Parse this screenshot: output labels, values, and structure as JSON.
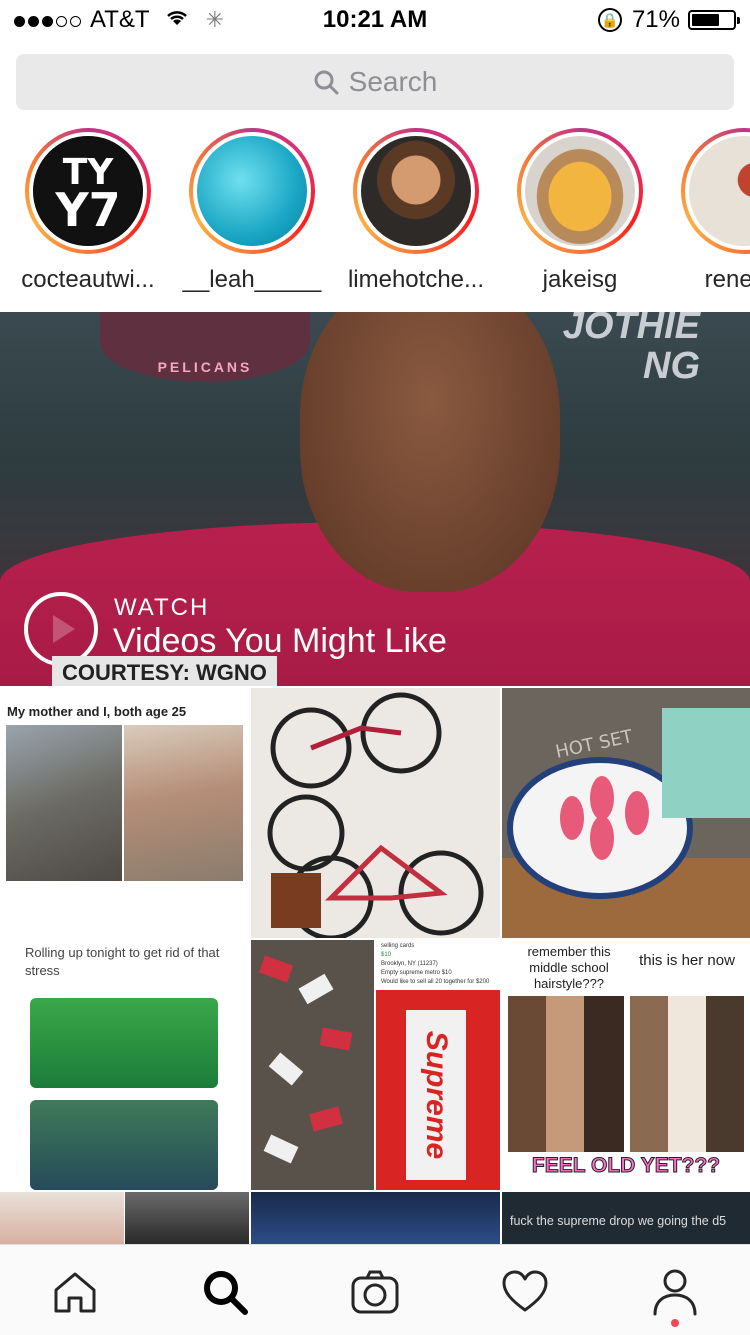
{
  "status_bar": {
    "carrier": "AT&T",
    "time": "10:21 AM",
    "battery_percent": "71%",
    "battery_level": 0.71,
    "signal_bars_filled": 3,
    "signal_bars_total": 5
  },
  "search": {
    "placeholder": "Search"
  },
  "stories": [
    {
      "username": "cocteautwi..."
    },
    {
      "username": "__leah_____"
    },
    {
      "username": "limehotche..."
    },
    {
      "username": "jakeisg"
    },
    {
      "username": "reneeis"
    }
  ],
  "featured": {
    "kicker": "WATCH",
    "title": "Videos You Might Like",
    "courtesy": "COURTESY: WGNO",
    "sign_text": "JOTHIE\nNG",
    "logo_text": "PELICANS"
  },
  "grid": {
    "post1_caption": "My mother and I, both age 25",
    "post2_caption": "Rolling up tonight to get rid of that stress",
    "post3_line1": "selling cards",
    "post3_line2": "$10",
    "post3_line3": "Brooklyn, NY (11237)",
    "post3_line4": "Empty supreme metro $10",
    "post3_line5": "Would like to sell all 20 together for $200",
    "post3_brand": "Supreme",
    "post4_left": "remember this middle school hairstyle???",
    "post4_right": "this is her now",
    "post4_bottom": "FEEL OLD YET???",
    "post5_caption": "fuck the supreme drop we going the d5",
    "hot_set": "HOT SET"
  },
  "tabbar": {
    "active_tab": "search",
    "items": [
      "home",
      "search",
      "camera",
      "activity",
      "profile"
    ]
  },
  "colors": {
    "story_ring_start": "#c13584",
    "story_ring_end": "#fcaf45",
    "notification_dot": "#ed4956"
  }
}
